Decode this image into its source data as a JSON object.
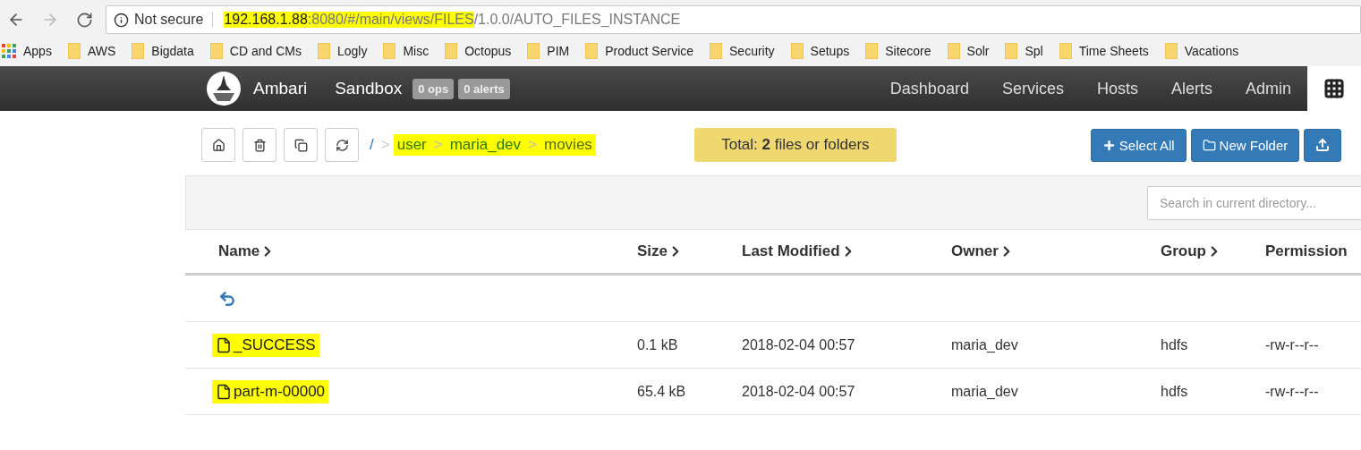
{
  "browser": {
    "security": "Not secure",
    "url": [
      {
        "text": "192.168.1.88",
        "kind": "host",
        "highlighted": true
      },
      {
        "text": ":8080/#/main/views/FILES",
        "kind": "path",
        "highlighted": true
      },
      {
        "text": "/1.0.0/AUTO_FILES_INSTANCE",
        "kind": "path",
        "highlighted": false
      }
    ],
    "bookmarks": [
      {
        "label": "Apps",
        "kind": "apps"
      },
      {
        "label": "AWS",
        "kind": "folder"
      },
      {
        "label": "Bigdata",
        "kind": "folder"
      },
      {
        "label": "CD and CMs",
        "kind": "folder"
      },
      {
        "label": "Logly",
        "kind": "folder"
      },
      {
        "label": "Misc",
        "kind": "folder"
      },
      {
        "label": "Octopus",
        "kind": "folder"
      },
      {
        "label": "PIM",
        "kind": "folder"
      },
      {
        "label": "Product Service",
        "kind": "folder"
      },
      {
        "label": "Security",
        "kind": "folder"
      },
      {
        "label": "Setups",
        "kind": "folder"
      },
      {
        "label": "Sitecore",
        "kind": "folder"
      },
      {
        "label": "Solr",
        "kind": "folder"
      },
      {
        "label": "Spl",
        "kind": "folder"
      },
      {
        "label": "Time Sheets",
        "kind": "folder"
      },
      {
        "label": "Vacations",
        "kind": "folder"
      }
    ]
  },
  "navbar": {
    "brand": "Ambari",
    "cluster": "Sandbox",
    "badges": [
      "0 ops",
      "0 alerts"
    ],
    "items": [
      "Dashboard",
      "Services",
      "Hosts",
      "Alerts",
      "Admin"
    ]
  },
  "breadcrumb": {
    "root": "/",
    "separator": ">",
    "parts": [
      {
        "text": "user",
        "highlighted": true
      },
      {
        "text": "maria_dev",
        "highlighted": true
      },
      {
        "text": "movies",
        "highlighted": true
      }
    ]
  },
  "total": {
    "prefix": "Total: ",
    "count": "2",
    "suffix": " files or folders"
  },
  "buttons": [
    {
      "label": "Select All",
      "kind": "plus"
    },
    {
      "label": "New Folder",
      "kind": "folder"
    },
    {
      "kind": "upload"
    }
  ],
  "search": {
    "placeholder": "Search in current directory..."
  },
  "table": {
    "columns": [
      "Name",
      "Size",
      "Last Modified",
      "Owner",
      "Group",
      "Permission"
    ],
    "rows": [
      {
        "name": "_SUCCESS",
        "highlighted": true,
        "size": "0.1 kB",
        "modified": "2018-02-04 00:57",
        "owner": "maria_dev",
        "group": "hdfs",
        "permission": "-rw-r--r--"
      },
      {
        "name": "part-m-00000",
        "highlighted": true,
        "size": "65.4 kB",
        "modified": "2018-02-04 00:57",
        "owner": "maria_dev",
        "group": "hdfs",
        "permission": "-rw-r--r--"
      }
    ]
  }
}
